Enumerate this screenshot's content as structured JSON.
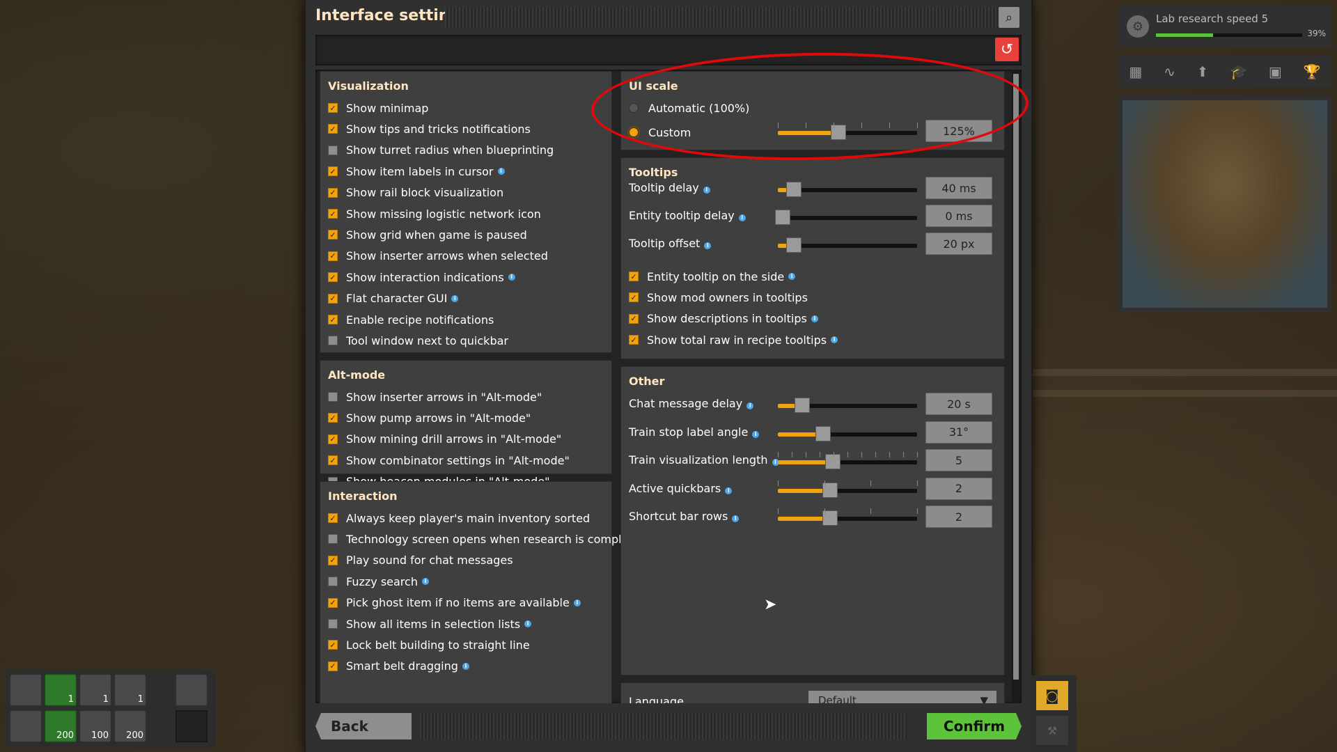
{
  "window": {
    "title": "Interface settings"
  },
  "visualization": {
    "heading": "Visualization",
    "items": [
      {
        "label": "Show minimap",
        "checked": true,
        "info": false
      },
      {
        "label": "Show tips and tricks notifications",
        "checked": true,
        "info": false
      },
      {
        "label": "Show turret radius when blueprinting",
        "checked": false,
        "info": false
      },
      {
        "label": "Show item labels in cursor",
        "checked": true,
        "info": true
      },
      {
        "label": "Show rail block visualization",
        "checked": true,
        "info": false
      },
      {
        "label": "Show missing logistic network icon",
        "checked": true,
        "info": false
      },
      {
        "label": "Show grid when game is paused",
        "checked": true,
        "info": false
      },
      {
        "label": "Show inserter arrows when selected",
        "checked": true,
        "info": false
      },
      {
        "label": "Show interaction indications",
        "checked": true,
        "info": true
      },
      {
        "label": "Flat character GUI",
        "checked": true,
        "info": true
      },
      {
        "label": "Enable recipe notifications",
        "checked": true,
        "info": false
      },
      {
        "label": "Tool window next to quickbar",
        "checked": false,
        "info": false
      }
    ]
  },
  "altmode": {
    "heading": "Alt-mode",
    "items": [
      {
        "label": "Show inserter arrows in \"Alt-mode\"",
        "checked": false
      },
      {
        "label": "Show pump arrows in \"Alt-mode\"",
        "checked": true
      },
      {
        "label": "Show mining drill arrows in \"Alt-mode\"",
        "checked": true
      },
      {
        "label": "Show combinator settings in \"Alt-mode\"",
        "checked": true
      },
      {
        "label": "Show beacon modules in \"Alt-mode\"",
        "checked": false
      }
    ]
  },
  "interaction": {
    "heading": "Interaction",
    "items": [
      {
        "label": "Always keep player's main inventory sorted",
        "checked": true,
        "info": false
      },
      {
        "label": "Technology screen opens when research is completed",
        "checked": false,
        "info": false
      },
      {
        "label": "Play sound for chat messages",
        "checked": true,
        "info": false
      },
      {
        "label": "Fuzzy search",
        "checked": false,
        "info": true
      },
      {
        "label": "Pick ghost item if no items are available",
        "checked": true,
        "info": true
      },
      {
        "label": "Show all items in selection lists",
        "checked": false,
        "info": true
      },
      {
        "label": "Lock belt building to straight line",
        "checked": true,
        "info": false
      },
      {
        "label": "Smart belt dragging",
        "checked": true,
        "info": true
      }
    ]
  },
  "uiscale": {
    "heading": "UI scale",
    "auto_label": "Automatic (100%)",
    "custom_label": "Custom",
    "selected": "custom",
    "slider_value": 0.4,
    "value_text": "125%"
  },
  "tooltips": {
    "heading": "Tooltips",
    "sliders": [
      {
        "label": "Tooltip delay",
        "value": "40 ms",
        "fill": 0.08
      },
      {
        "label": "Entity tooltip delay",
        "value": "0 ms",
        "fill": 0.0
      },
      {
        "label": "Tooltip offset",
        "value": "20 px",
        "fill": 0.08
      }
    ],
    "checks": [
      {
        "label": "Entity tooltip on the side",
        "checked": true,
        "info": true
      },
      {
        "label": "Show mod owners in tooltips",
        "checked": true,
        "info": false
      },
      {
        "label": "Show descriptions in tooltips",
        "checked": true,
        "info": true
      },
      {
        "label": "Show total raw in recipe tooltips",
        "checked": true,
        "info": true
      }
    ]
  },
  "other": {
    "heading": "Other",
    "sliders": [
      {
        "label": "Chat message delay",
        "value": "20 s",
        "fill": 0.14
      },
      {
        "label": "Train stop label angle",
        "value": "31°",
        "fill": 0.29
      },
      {
        "label": "Train visualization length",
        "value": "5",
        "fill": 0.36
      },
      {
        "label": "Active quickbars",
        "value": "2",
        "fill": 0.34
      },
      {
        "label": "Shortcut bar rows",
        "value": "2",
        "fill": 0.34
      }
    ],
    "language_label": "Language",
    "language_value": "Default"
  },
  "buttons": {
    "back": "Back",
    "confirm": "Confirm"
  },
  "research": {
    "label": "Lab research speed 5",
    "percent": "39%",
    "progress": 0.39
  },
  "quickbar": {
    "counts": [
      "1",
      "1",
      "1",
      "200",
      "100",
      "200"
    ]
  },
  "colors": {
    "accent": "#f2a20e",
    "confirm": "#5dc33a",
    "reset": "#e8413b",
    "annotation": "#e10a0a"
  },
  "icons": [
    "search-icon",
    "reset-icon",
    "info-icon",
    "lab-icon",
    "cursor-icon"
  ]
}
